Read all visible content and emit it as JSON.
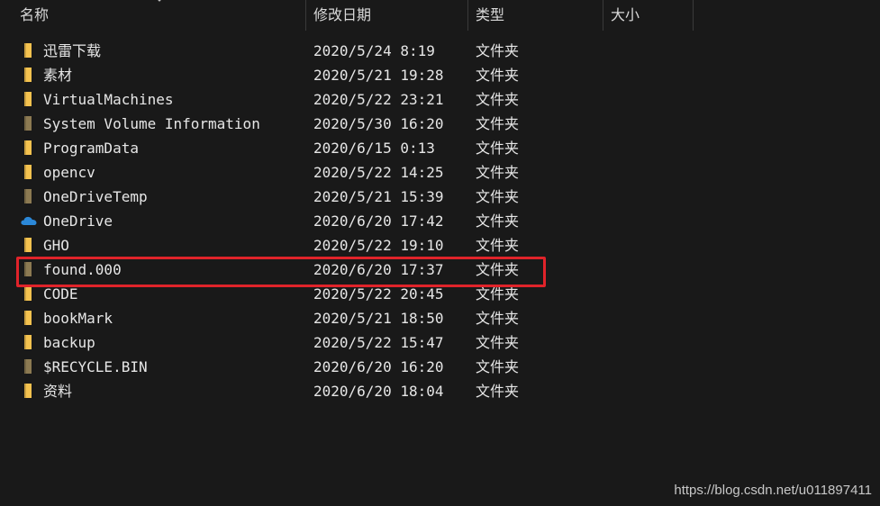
{
  "header": {
    "name_label": "名称",
    "date_label": "修改日期",
    "type_label": "类型",
    "size_label": "大小"
  },
  "colors": {
    "background": "#191919",
    "folder_yellow": "#f3c24f",
    "folder_hidden": "#8c7a52",
    "onedrive_blue": "#2b88d8",
    "highlight_red": "#e0232a"
  },
  "files": [
    {
      "name": "迅雷下载",
      "date": "2020/5/24 8:19",
      "type": "文件夹",
      "icon": "folder-icon"
    },
    {
      "name": "素材",
      "date": "2020/5/21 19:28",
      "type": "文件夹",
      "icon": "folder-icon"
    },
    {
      "name": "VirtualMachines",
      "date": "2020/5/22 23:21",
      "type": "文件夹",
      "icon": "folder-icon"
    },
    {
      "name": "System Volume Information",
      "date": "2020/5/30 16:20",
      "type": "文件夹",
      "icon": "hidden-folder-icon"
    },
    {
      "name": "ProgramData",
      "date": "2020/6/15 0:13",
      "type": "文件夹",
      "icon": "folder-icon"
    },
    {
      "name": "opencv",
      "date": "2020/5/22 14:25",
      "type": "文件夹",
      "icon": "folder-icon"
    },
    {
      "name": "OneDriveTemp",
      "date": "2020/5/21 15:39",
      "type": "文件夹",
      "icon": "hidden-folder-icon"
    },
    {
      "name": "OneDrive",
      "date": "2020/6/20 17:42",
      "type": "文件夹",
      "icon": "onedrive-cloud-icon"
    },
    {
      "name": "GHO",
      "date": "2020/5/22 19:10",
      "type": "文件夹",
      "icon": "folder-icon"
    },
    {
      "name": "found.000",
      "date": "2020/6/20 17:37",
      "type": "文件夹",
      "icon": "hidden-folder-icon"
    },
    {
      "name": "CODE",
      "date": "2020/5/22 20:45",
      "type": "文件夹",
      "icon": "folder-icon"
    },
    {
      "name": "bookMark",
      "date": "2020/5/21 18:50",
      "type": "文件夹",
      "icon": "folder-icon"
    },
    {
      "name": "backup",
      "date": "2020/5/22 15:47",
      "type": "文件夹",
      "icon": "folder-icon"
    },
    {
      "name": "$RECYCLE.BIN",
      "date": "2020/6/20 16:20",
      "type": "文件夹",
      "icon": "hidden-folder-icon"
    },
    {
      "name": "资料",
      "date": "2020/6/20 18:04",
      "type": "文件夹",
      "icon": "folder-icon"
    }
  ],
  "watermark": "https://blog.csdn.net/u011897411"
}
